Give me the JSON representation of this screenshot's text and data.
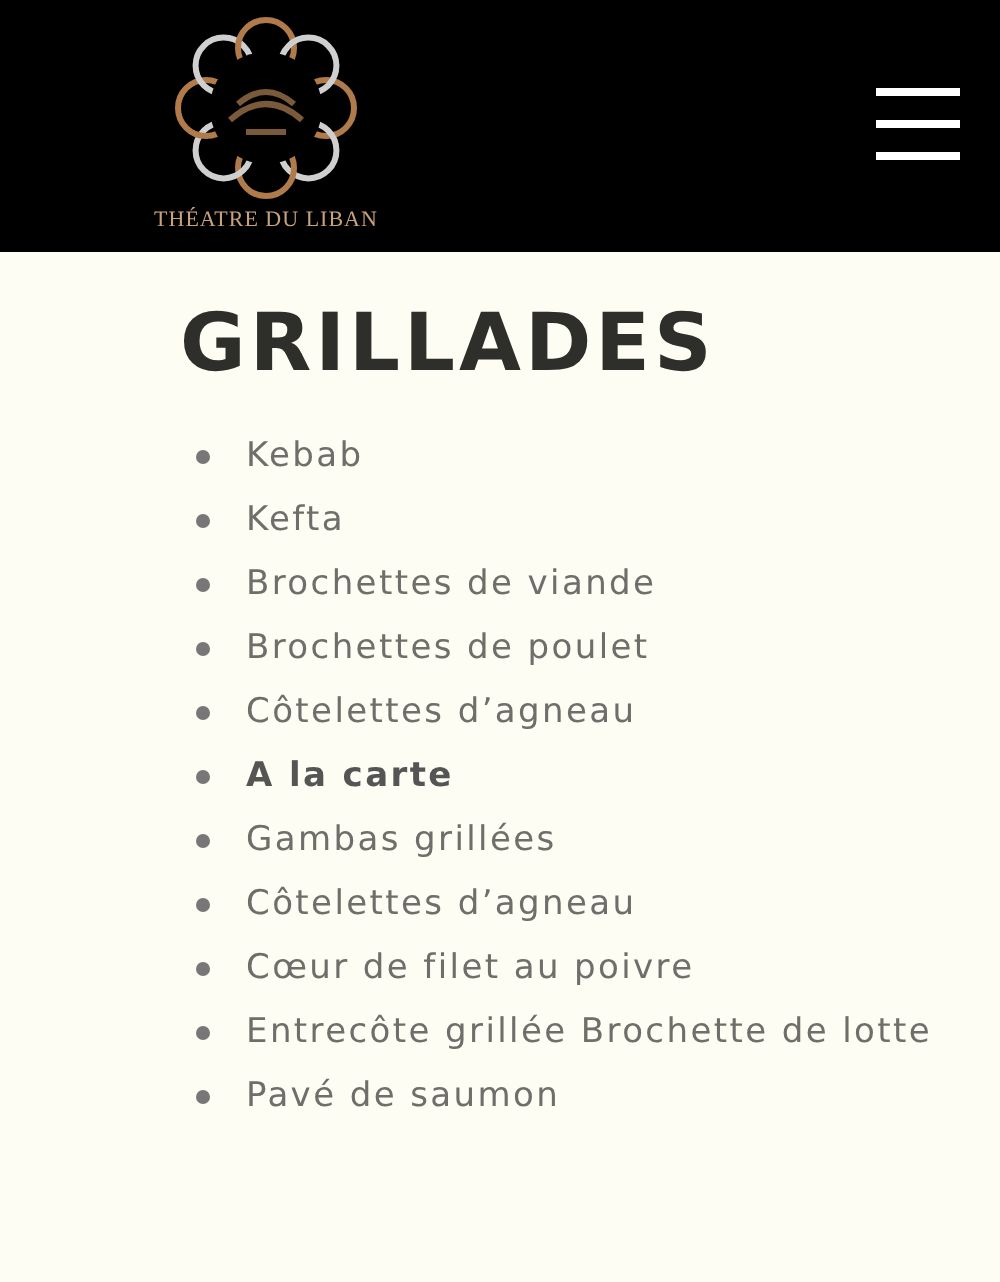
{
  "header": {
    "logo_text": "THÉATRE DU LIBAN"
  },
  "section": {
    "title": "GRILLADES",
    "items": [
      {
        "label": "Kebab",
        "kind": "dish"
      },
      {
        "label": "Kefta",
        "kind": "dish"
      },
      {
        "label": "Brochettes de viande",
        "kind": "dish"
      },
      {
        "label": "Brochettes de poulet",
        "kind": "dish"
      },
      {
        "label": "Côtelettes d’agneau",
        "kind": "dish"
      },
      {
        "label": "A la carte",
        "kind": "heading"
      },
      {
        "label": "Gambas grillées",
        "kind": "dish"
      },
      {
        "label": "Côtelettes d’agneau",
        "kind": "dish"
      },
      {
        "label": "Cœur de filet au poivre",
        "kind": "dish"
      },
      {
        "label": "Entrecôte grillée Brochette de lotte",
        "kind": "dish"
      },
      {
        "label": "Pavé de saumon",
        "kind": "dish"
      }
    ]
  }
}
